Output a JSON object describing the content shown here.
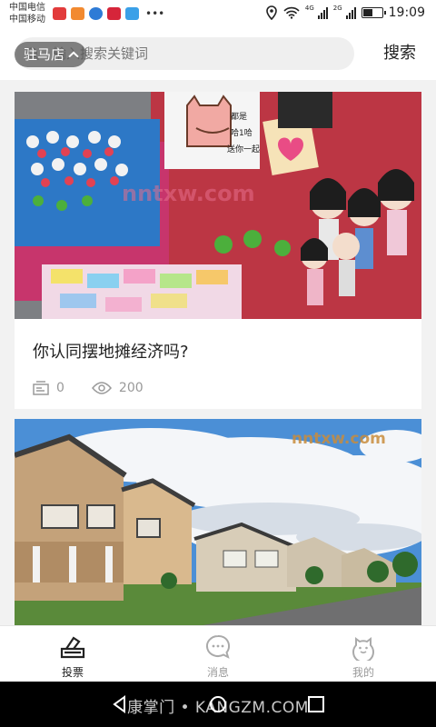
{
  "status_bar": {
    "carrier_1": "中国电信",
    "carrier_2": "中国移动",
    "network_1": "4G",
    "network_2": "2G",
    "battery_level": 0.55,
    "time": "19:09"
  },
  "header": {
    "location": "驻马店",
    "search_placeholder": "输入搜索关键词",
    "search_button": "搜索"
  },
  "feed": {
    "cards": [
      {
        "image_watermark": "nntxw.com",
        "image_sign_text": "都是\n哈1哈\n送你一起",
        "title": "你认同摆地摊经济吗?",
        "comments": "0",
        "views": "200"
      },
      {
        "image_watermark": "nntxw.com"
      }
    ]
  },
  "tabbar": {
    "tabs": [
      {
        "label": "投票",
        "icon": "vote-icon",
        "active": true
      },
      {
        "label": "消息",
        "icon": "message-icon",
        "active": false
      },
      {
        "label": "我的",
        "icon": "profile-icon",
        "active": false
      }
    ]
  },
  "system_nav": {
    "watermark": "康掌门 • KANGZM.COM"
  },
  "colors": {
    "accent": "#222222",
    "inactive": "#999999",
    "background": "#f2f2f2"
  }
}
